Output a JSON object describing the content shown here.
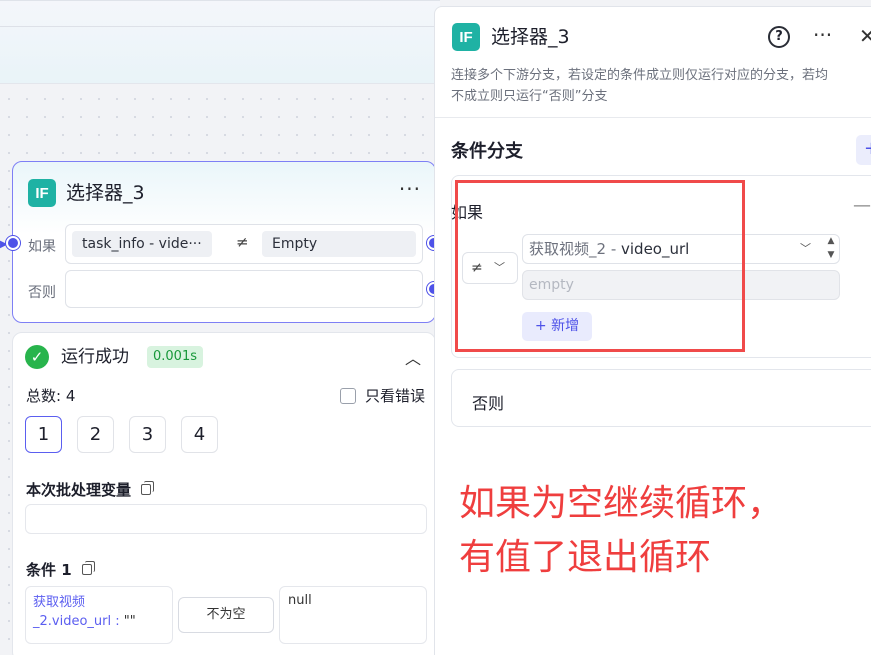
{
  "node": {
    "badge": "IF",
    "title": "选择器_3",
    "more": "···",
    "if_label": "如果",
    "else_label": "否则",
    "left_operand": "task_info  -  vide···",
    "operator": "≠",
    "right_operand": "Empty"
  },
  "run": {
    "status": "运行成功",
    "duration": "0.001s",
    "total": "总数: 4",
    "only_errors": "只看错误",
    "pages": [
      "1",
      "2",
      "3",
      "4"
    ],
    "active_page": "1",
    "batch_vars_label": "本次批处理变量",
    "condition_label": "条件 1",
    "cond_var_line1": "获取视频",
    "cond_var_line2": "_2.video_url : ",
    "cond_var_value": "\"\"",
    "cond_op": "不为空",
    "cond_value": "null"
  },
  "panel": {
    "badge": "IF",
    "title": "选择器_3",
    "help": "?",
    "more": "···",
    "close": "✕",
    "desc_line1": "连接多个下游分支，若设定的条件成立则仅运行对应的分支，若均",
    "desc_line2": "不成立则只运行“否则”分支",
    "branch_title": "条件分支",
    "add": "+",
    "if_label": "如果",
    "collapse": "—",
    "operator": "≠",
    "var_node": "获取视频_2",
    "var_sep": " - ",
    "var_name": "video_url",
    "value_placeholder": "empty",
    "new_label": "+ 新增",
    "else_label": "否则"
  },
  "annotation": {
    "line1": "如果为空继续循环，",
    "line2": "有值了退出循环"
  },
  "colors": {
    "accent": "#4e52e8",
    "if_badge": "#1fb2a4",
    "success": "#28b44c",
    "annotation": "#ef3e3e"
  }
}
